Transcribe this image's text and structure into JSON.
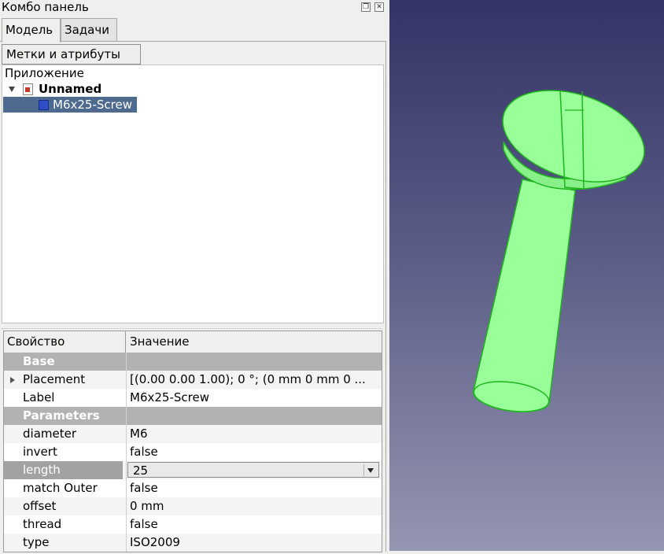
{
  "panel": {
    "title": "Комбо панель",
    "tabs": [
      {
        "label": "Модель",
        "active": true
      },
      {
        "label": "Задачи",
        "active": false
      }
    ],
    "header_button": "Метки и атрибуты"
  },
  "tree": {
    "root_label": "Приложение",
    "document": "Unnamed",
    "object": "M6x25-Screw"
  },
  "properties": {
    "columns": [
      "Свойство",
      "Значение"
    ],
    "groups": [
      {
        "name": "Base",
        "rows": [
          {
            "name": "Placement",
            "value": "[(0.00 0.00 1.00); 0 °; (0 mm  0 mm  0 ..."
          },
          {
            "name": "Label",
            "value": "M6x25-Screw"
          }
        ]
      },
      {
        "name": "Parameters",
        "rows": [
          {
            "name": "diameter",
            "value": "M6"
          },
          {
            "name": "invert",
            "value": "false"
          },
          {
            "name": "length",
            "value": "25",
            "selected": true
          },
          {
            "name": "match Outer",
            "value": "false"
          },
          {
            "name": "offset",
            "value": "0 mm"
          },
          {
            "name": "thread",
            "value": "false"
          },
          {
            "name": "type",
            "value": "ISO2009"
          }
        ]
      }
    ]
  },
  "viewport": {
    "model_color": "#99ff99",
    "edge_color": "#1fb51f",
    "background_top": "#333466",
    "background_bottom": "#9596b0"
  }
}
